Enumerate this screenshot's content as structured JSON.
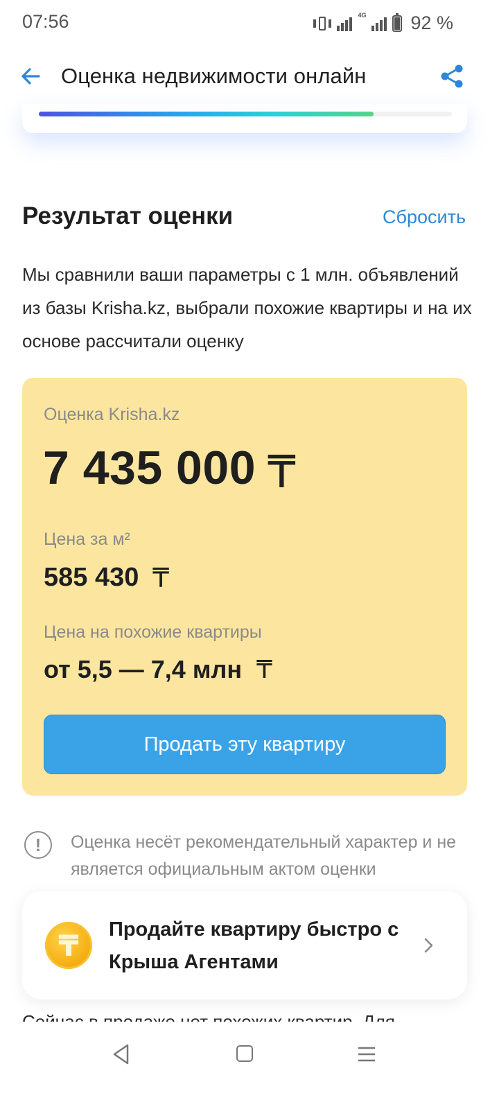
{
  "status_bar": {
    "time": "07:56",
    "network": "4G",
    "battery": "92 %",
    "icons": [
      "vibrate-icon",
      "signal-icon",
      "battery-icon"
    ]
  },
  "app_bar": {
    "title": "Оценка недвижимости онлайн",
    "back_icon": "arrow-left-icon",
    "share_icon": "share-icon",
    "accent_color": "#2f86d8"
  },
  "progress": {
    "value_percent": 81
  },
  "result": {
    "title": "Результат оценки",
    "reset_label": "Сбросить",
    "description": "Мы сравнили ваши параметры с 1 млн. объявлений из базы Krisha.kz, выбрали похожие квартиры и на их основе рассчитали оценку"
  },
  "estimate_card": {
    "background": "#fce69f",
    "estimate_label": "Оценка Krisha.kz",
    "estimate_value": "7 435 000",
    "currency": "₸",
    "sqm_label": "Цена за м²",
    "sqm_value": "585 430",
    "similar_label": "Цена на похожие квартиры",
    "similar_value": "от 5,5 — 7,4 млн",
    "sell_button": "Продать эту квартиру",
    "button_color": "#3aa3e8"
  },
  "disclaimer": {
    "icon": "exclamation-circle-icon",
    "text": "Оценка несёт рекомендательный характер и не является официальным актом оценки"
  },
  "agent_card": {
    "icon": "tenge-coin-icon",
    "coin_symbol": "₸",
    "text": "Продайте квартиру быстро с Крыша Агентами",
    "chevron": "chevron-right-icon"
  },
  "bottom_text": "Сейчас в продаже нет похожих квартир. Для",
  "nav_bar": {
    "icons": [
      "nav-back-icon",
      "nav-home-icon",
      "nav-menu-icon"
    ]
  }
}
